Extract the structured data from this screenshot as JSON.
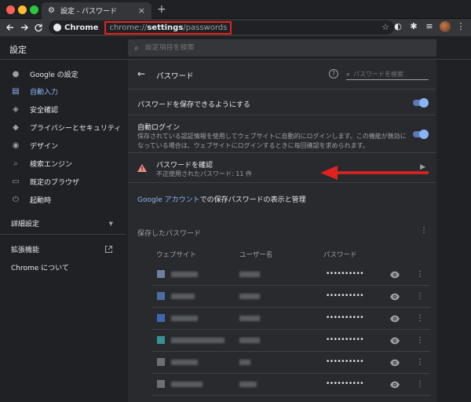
{
  "tab": {
    "title": "設定 - パスワード",
    "close": "×",
    "new": "+"
  },
  "toolbar": {
    "chrome_label": "Chrome",
    "url_scheme": "chrome://",
    "url_host": "settings",
    "url_path": "/passwords"
  },
  "header": {
    "title": "設定",
    "search_placeholder": "設定項目を検索"
  },
  "sidebar": {
    "items": [
      {
        "label": "Google の設定",
        "icon": "person-icon"
      },
      {
        "label": "自動入力",
        "icon": "autofill-icon",
        "active": true
      },
      {
        "label": "安全確認",
        "icon": "shield-check-icon"
      },
      {
        "label": "プライバシーとセキュリティ",
        "icon": "shield-icon"
      },
      {
        "label": "デザイン",
        "icon": "palette-icon"
      },
      {
        "label": "検索エンジン",
        "icon": "search-icon"
      },
      {
        "label": "既定のブラウザ",
        "icon": "browser-icon"
      },
      {
        "label": "起動時",
        "icon": "power-icon"
      }
    ],
    "advanced": "詳細設定",
    "extensions": "拡張機能",
    "about": "Chrome について"
  },
  "passwords": {
    "title": "パスワード",
    "search_placeholder": "パスワードを検索",
    "offer_save_label": "パスワードを保存できるようにする",
    "offer_save_enabled": true,
    "auto_signin_label": "自動ログイン",
    "auto_signin_desc": "保存されている認証情報を使用してウェブサイトに自動的にログインします。この機能が無効になっている場合は、ウェブサイトにログインするときに毎回確認を求められます。",
    "auto_signin_enabled": true,
    "check_label": "パスワードを確認",
    "check_sub": "不正使用されたパスワード: 11 件",
    "google_link": "Google アカウント",
    "google_rest": "での保存パスワードの表示と管理",
    "saved_heading": "保存したパスワード",
    "columns": {
      "website": "ウェブサイト",
      "username": "ユーザー名",
      "password": "パスワード"
    },
    "rows": [
      {
        "password_mask": "••••••••••",
        "favicon_color": "#6b7f9e"
      },
      {
        "password_mask": "••••••••••",
        "favicon_color": "#4a6fa5"
      },
      {
        "password_mask": "••••••••••",
        "favicon_color": "#3f67b0"
      },
      {
        "password_mask": "••••••••••",
        "favicon_color": "#3a8f8f"
      },
      {
        "password_mask": "••••••••••",
        "favicon_color": "#6d6f73"
      },
      {
        "password_mask": "••••••••••",
        "favicon_color": "#6d6f73"
      }
    ]
  },
  "colors": {
    "accent": "#8ab4f8",
    "annotation_red": "#e0221f",
    "warning": "#f28b82"
  }
}
